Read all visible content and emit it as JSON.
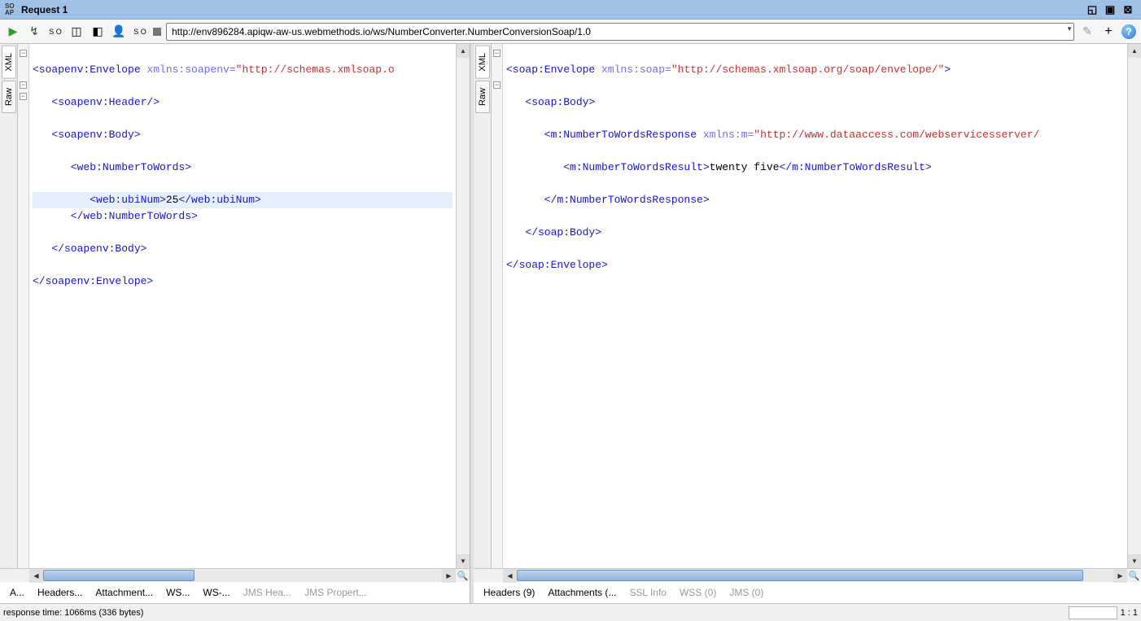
{
  "window": {
    "title": "Request 1",
    "soap_s": "SO",
    "soap_a": "AP"
  },
  "toolbar": {
    "url": "http://env896284.apiqw-aw-us.webmethods.io/ws/NumberConverter.NumberConversionSoap/1.0"
  },
  "side_tabs": {
    "xml": "XML",
    "raw": "Raw"
  },
  "request_xml": {
    "l1_open": "<soapenv:Envelope",
    "l1_attr": " xmlns:soapenv=",
    "l1_val": "\"http://schemas.xmlsoap.o",
    "l2": "   <soapenv:Header/>",
    "l3": "   <soapenv:Body>",
    "l4": "      <web:NumberToWords>",
    "l5_a": "         <web:ubiNum>",
    "l5_b": "25",
    "l5_c": "</web:ubiNum>",
    "l6": "      </web:NumberToWords>",
    "l7": "   </soapenv:Body>",
    "l8": "</soapenv:Envelope>"
  },
  "response_xml": {
    "l1_open": "<soap:Envelope",
    "l1_attr": " xmlns:soap=",
    "l1_val": "\"http://schemas.xmlsoap.org/soap/envelope/\"",
    "l1_close": ">",
    "l2": "   <soap:Body>",
    "l3_a": "      <m:NumberToWordsResponse",
    "l3_b": " xmlns:m=",
    "l3_c": "\"http://www.dataaccess.com/webservicesserver/",
    "l4_a": "         <m:NumberToWordsResult>",
    "l4_b": "twenty five",
    "l4_c": "</m:NumberToWordsResult>",
    "l5": "      </m:NumberToWordsResponse>",
    "l6": "   </soap:Body>",
    "l7": "</soap:Envelope>"
  },
  "left_tabs": {
    "t0": "A...",
    "t1": "Headers...",
    "t2": "Attachment...",
    "t3": "WS...",
    "t4": "WS-...",
    "t5": "JMS Hea...",
    "t6": "JMS Propert..."
  },
  "right_tabs": {
    "t0": "Headers (9)",
    "t1": "Attachments (...",
    "t2": "SSL Info",
    "t3": "WSS (0)",
    "t4": "JMS (0)"
  },
  "status": {
    "left": "response time: 1066ms (336 bytes)",
    "pos": "1 : 1"
  },
  "fold": {
    "minus": "−"
  }
}
